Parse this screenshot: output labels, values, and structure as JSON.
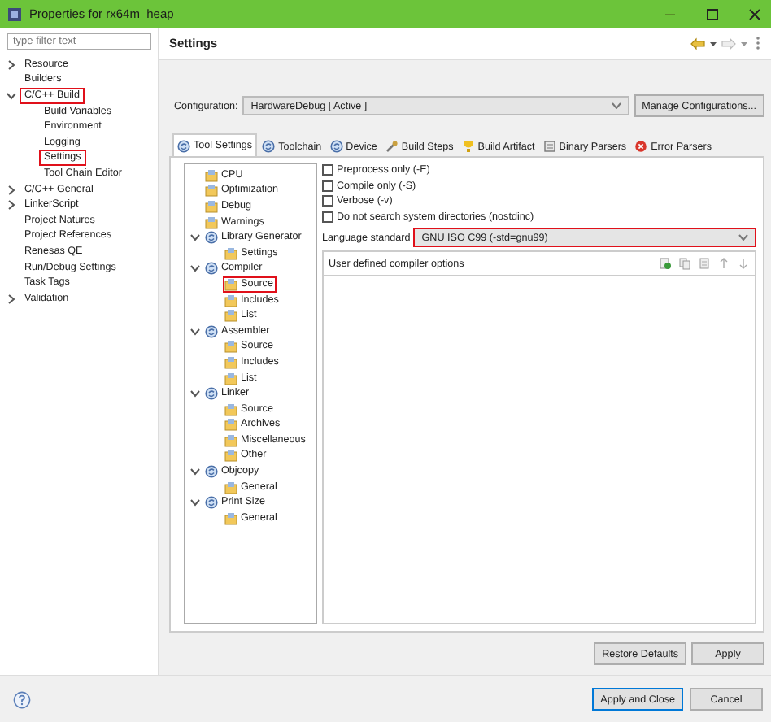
{
  "window": {
    "title": "Properties for rx64m_heap"
  },
  "filter": {
    "placeholder": "type filter text"
  },
  "nav_tree": [
    {
      "label": "Resource",
      "expanded": false,
      "highlighted": false
    },
    {
      "label": "Builders",
      "highlighted": false
    },
    {
      "label": "C/C++ Build",
      "expanded": true,
      "highlighted": true,
      "children": [
        {
          "label": "Build Variables",
          "highlighted": false
        },
        {
          "label": "Environment",
          "highlighted": false
        },
        {
          "label": "Logging",
          "highlighted": false
        },
        {
          "label": "Settings",
          "highlighted": true
        },
        {
          "label": "Tool Chain Editor",
          "highlighted": false
        }
      ]
    },
    {
      "label": "C/C++ General",
      "expanded": false,
      "highlighted": false
    },
    {
      "label": "LinkerScript",
      "expanded": false,
      "highlighted": false
    },
    {
      "label": "Project Natures",
      "highlighted": false
    },
    {
      "label": "Project References",
      "highlighted": false
    },
    {
      "label": "Renesas QE",
      "highlighted": false
    },
    {
      "label": "Run/Debug Settings",
      "highlighted": false
    },
    {
      "label": "Task Tags",
      "highlighted": false
    },
    {
      "label": "Validation",
      "expanded": false,
      "highlighted": false
    }
  ],
  "page": {
    "title": "Settings"
  },
  "configuration": {
    "label": "Configuration:",
    "value": "HardwareDebug  [ Active ]",
    "button": "Manage Configurations..."
  },
  "tabs": [
    {
      "label": "Tool Settings",
      "kind": "tool",
      "selected": true
    },
    {
      "label": "Toolchain",
      "kind": "tool",
      "selected": false
    },
    {
      "label": "Device",
      "kind": "tool",
      "selected": false
    },
    {
      "label": "Build Steps",
      "kind": "wrench",
      "selected": false
    },
    {
      "label": "Build Artifact",
      "kind": "artifact",
      "selected": false
    },
    {
      "label": "Binary Parsers",
      "kind": "parser",
      "selected": false
    },
    {
      "label": "Error Parsers",
      "kind": "error",
      "selected": false
    }
  ],
  "tool_tree": [
    {
      "label": "CPU",
      "highlighted": false
    },
    {
      "label": "Optimization",
      "highlighted": false
    },
    {
      "label": "Debug",
      "highlighted": false
    },
    {
      "label": "Warnings",
      "highlighted": false
    },
    {
      "label": "Library Generator",
      "expanded": true,
      "highlighted": false,
      "children": [
        {
          "label": "Settings",
          "highlighted": false
        }
      ]
    },
    {
      "label": "Compiler",
      "expanded": true,
      "highlighted": false,
      "children": [
        {
          "label": "Source",
          "highlighted": true
        },
        {
          "label": "Includes",
          "highlighted": false
        },
        {
          "label": "List",
          "highlighted": false
        }
      ]
    },
    {
      "label": "Assembler",
      "expanded": true,
      "highlighted": false,
      "children": [
        {
          "label": "Source",
          "highlighted": false
        },
        {
          "label": "Includes",
          "highlighted": false
        },
        {
          "label": "List",
          "highlighted": false
        }
      ]
    },
    {
      "label": "Linker",
      "expanded": true,
      "highlighted": false,
      "children": [
        {
          "label": "Source",
          "highlighted": false
        },
        {
          "label": "Archives",
          "highlighted": false
        },
        {
          "label": "Miscellaneous",
          "highlighted": false
        },
        {
          "label": "Other",
          "highlighted": false
        }
      ]
    },
    {
      "label": "Objcopy",
      "expanded": true,
      "highlighted": false,
      "children": [
        {
          "label": "General",
          "highlighted": false
        }
      ]
    },
    {
      "label": "Print Size",
      "expanded": true,
      "highlighted": false,
      "children": [
        {
          "label": "General",
          "highlighted": false
        }
      ]
    }
  ],
  "options": [
    {
      "label": "Preprocess only (-E)",
      "checked": false
    },
    {
      "label": "Compile only (-S)",
      "checked": false
    },
    {
      "label": "Verbose (-v)",
      "checked": false
    },
    {
      "label": "Do not search system directories (nostdinc)",
      "checked": false
    }
  ],
  "language_standard": {
    "label": "Language standard",
    "value": "GNU ISO C99 (-std=gnu99)",
    "highlighted": true
  },
  "user_options": {
    "title": "User defined compiler options"
  },
  "buttons": {
    "restore": "Restore Defaults",
    "apply": "Apply",
    "apply_close": "Apply and Close",
    "cancel": "Cancel"
  }
}
